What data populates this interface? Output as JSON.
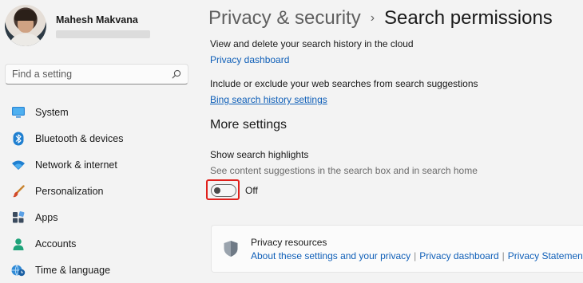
{
  "profile": {
    "name": "Mahesh Makvana"
  },
  "search": {
    "placeholder": "Find a setting",
    "icon": "search-icon"
  },
  "sidebar": {
    "items": [
      {
        "label": "System",
        "icon": "monitor-icon"
      },
      {
        "label": "Bluetooth & devices",
        "icon": "bluetooth-icon"
      },
      {
        "label": "Network & internet",
        "icon": "wifi-icon"
      },
      {
        "label": "Personalization",
        "icon": "brush-icon"
      },
      {
        "label": "Apps",
        "icon": "apps-icon"
      },
      {
        "label": "Accounts",
        "icon": "person-icon"
      },
      {
        "label": "Time & language",
        "icon": "globe-clock-icon"
      }
    ]
  },
  "breadcrumb": {
    "parent": "Privacy & security",
    "separator": "›",
    "current": "Search permissions"
  },
  "cloud": {
    "text": "View and delete your search history in the cloud",
    "link": "Privacy dashboard"
  },
  "web_search": {
    "text": "Include or exclude your web searches from search suggestions",
    "link": "Bing search history settings"
  },
  "more_settings": {
    "title": "More settings",
    "highlights_label": "Show search highlights",
    "highlights_desc": "See content suggestions in the search box and in search home",
    "toggle_state": "Off",
    "toggle_on": false
  },
  "privacy_resources": {
    "title": "Privacy resources",
    "links": [
      "About these settings and your privacy",
      "Privacy dashboard",
      "Privacy Statement"
    ],
    "separator": "|"
  },
  "colors": {
    "link": "#0f5fb8",
    "highlight_border": "#e0201b",
    "background": "#f3f3f3"
  }
}
